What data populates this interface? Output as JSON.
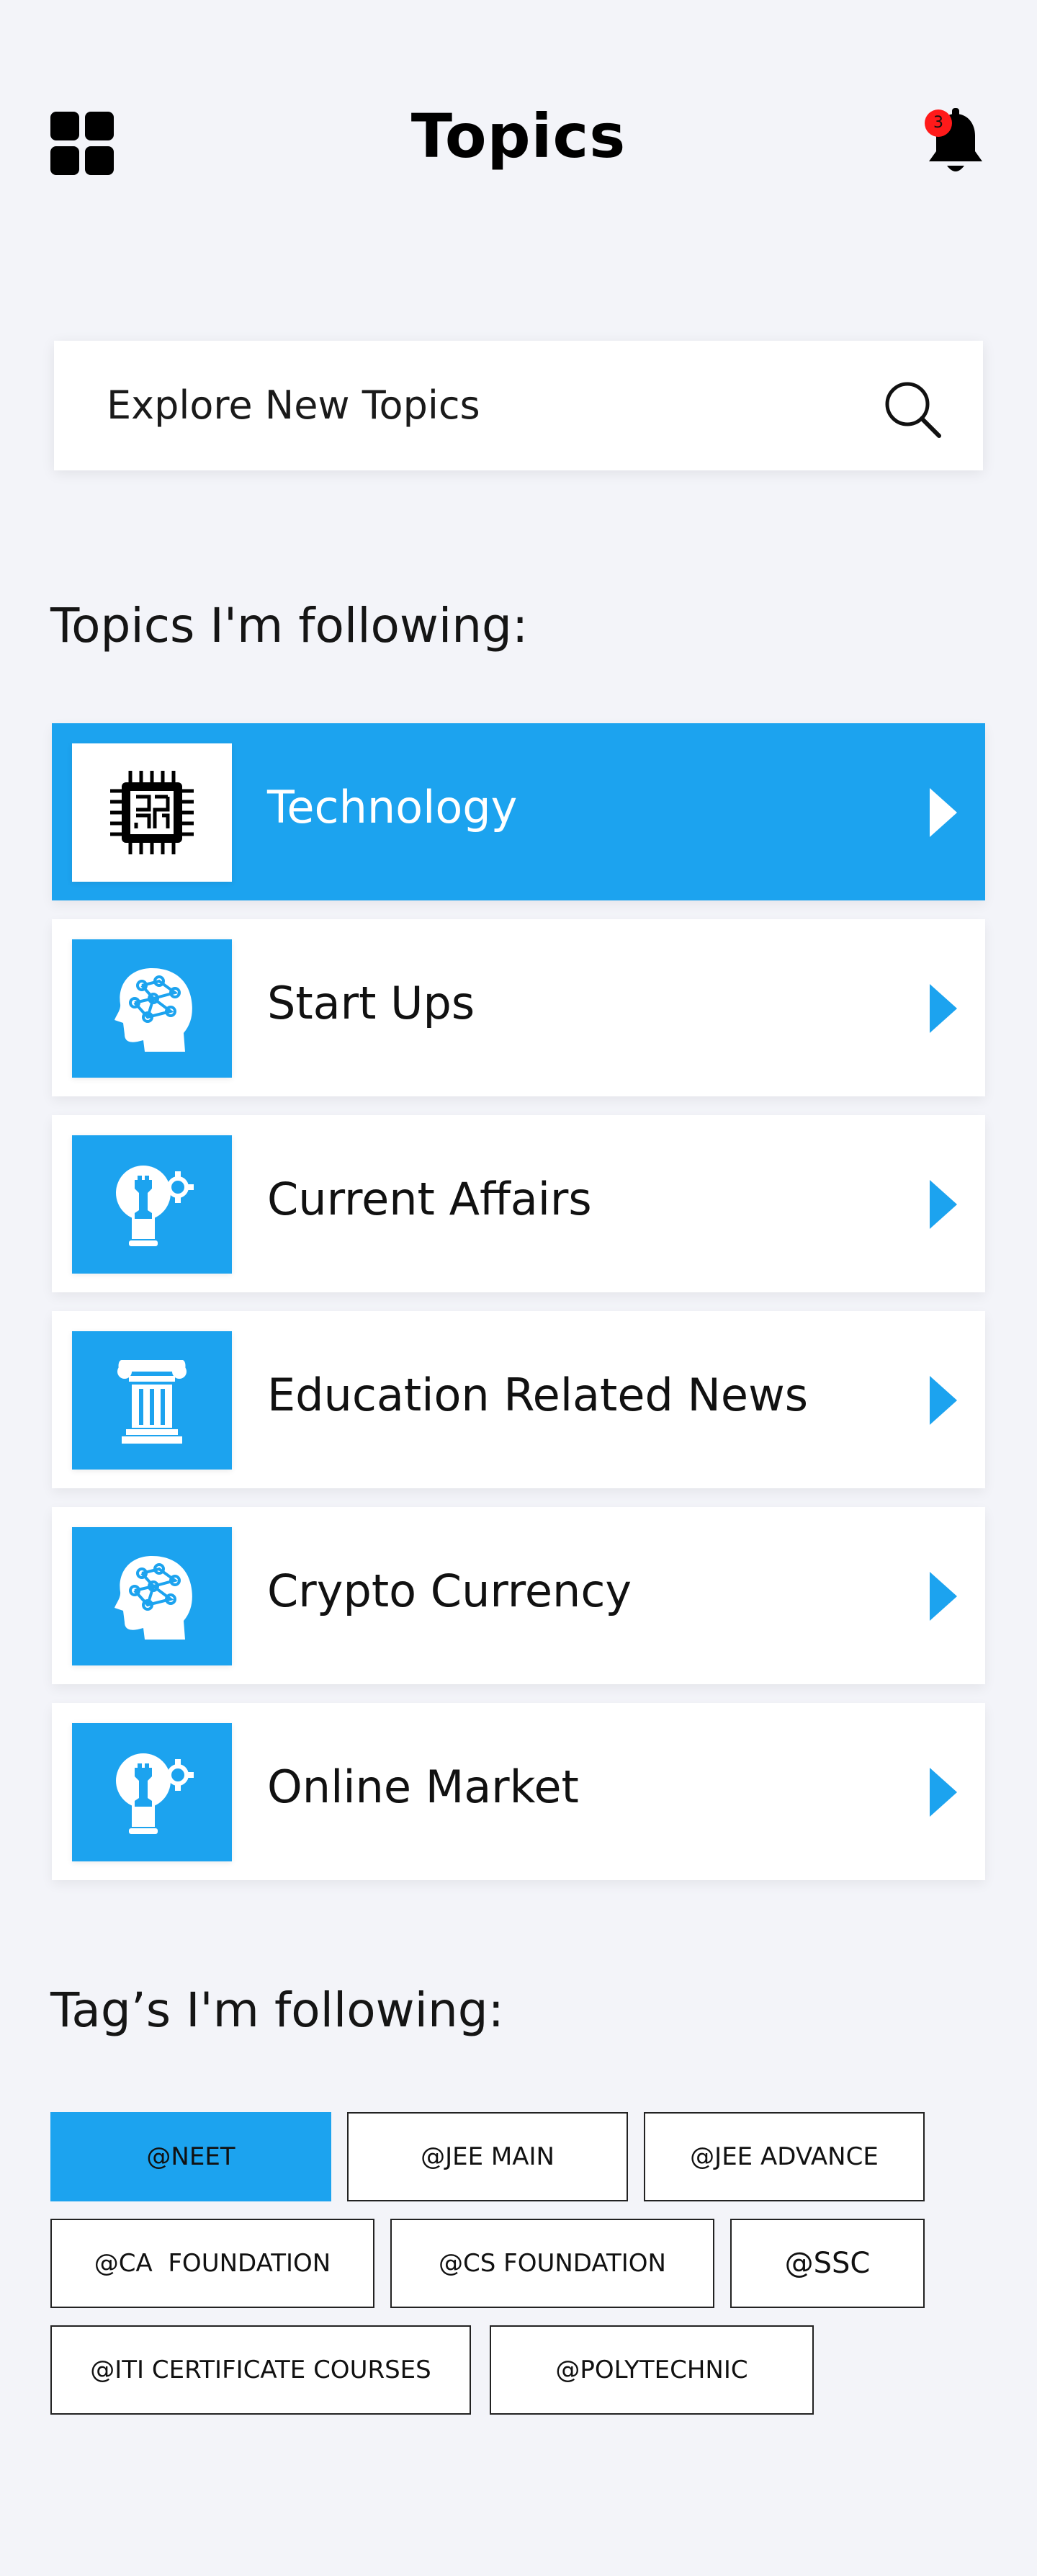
{
  "header": {
    "title": "Topics",
    "notification_count": "3",
    "menu_icon": "grid-icon",
    "bell_icon": "bell-icon"
  },
  "search": {
    "placeholder": "Explore New Topics",
    "icon": "search-icon"
  },
  "following_topics": {
    "title": "Topics I'm following:",
    "items": [
      {
        "label": "Technology",
        "icon": "chip-icon",
        "active": true
      },
      {
        "label": "Start Ups",
        "icon": "brain-head-icon",
        "active": false
      },
      {
        "label": "Current Affairs",
        "icon": "idea-strategy-icon",
        "active": false
      },
      {
        "label": "Education Related News",
        "icon": "pillar-icon",
        "active": false
      },
      {
        "label": "Crypto Currency",
        "icon": "brain-head-icon",
        "active": false
      },
      {
        "label": "Online Market",
        "icon": "idea-strategy-icon",
        "active": false
      }
    ]
  },
  "following_tags": {
    "title": "Tag’s I'm following:",
    "items": [
      {
        "label": "@NEET",
        "active": true
      },
      {
        "label": "@JEE MAIN",
        "active": false
      },
      {
        "label": "@JEE ADVANCE",
        "active": false
      },
      {
        "label": "@CA  FOUNDATION",
        "active": false
      },
      {
        "label": "@CS FOUNDATION",
        "active": false
      },
      {
        "label": "@SSC",
        "active": false
      },
      {
        "label": "@ITI CERTIFICATE COURSES",
        "active": false
      },
      {
        "label": "@POLYTECHNIC",
        "active": false
      }
    ]
  },
  "colors": {
    "accent": "#1ca3ef",
    "background": "#f3f4f9",
    "badge": "#ff1a1a"
  }
}
